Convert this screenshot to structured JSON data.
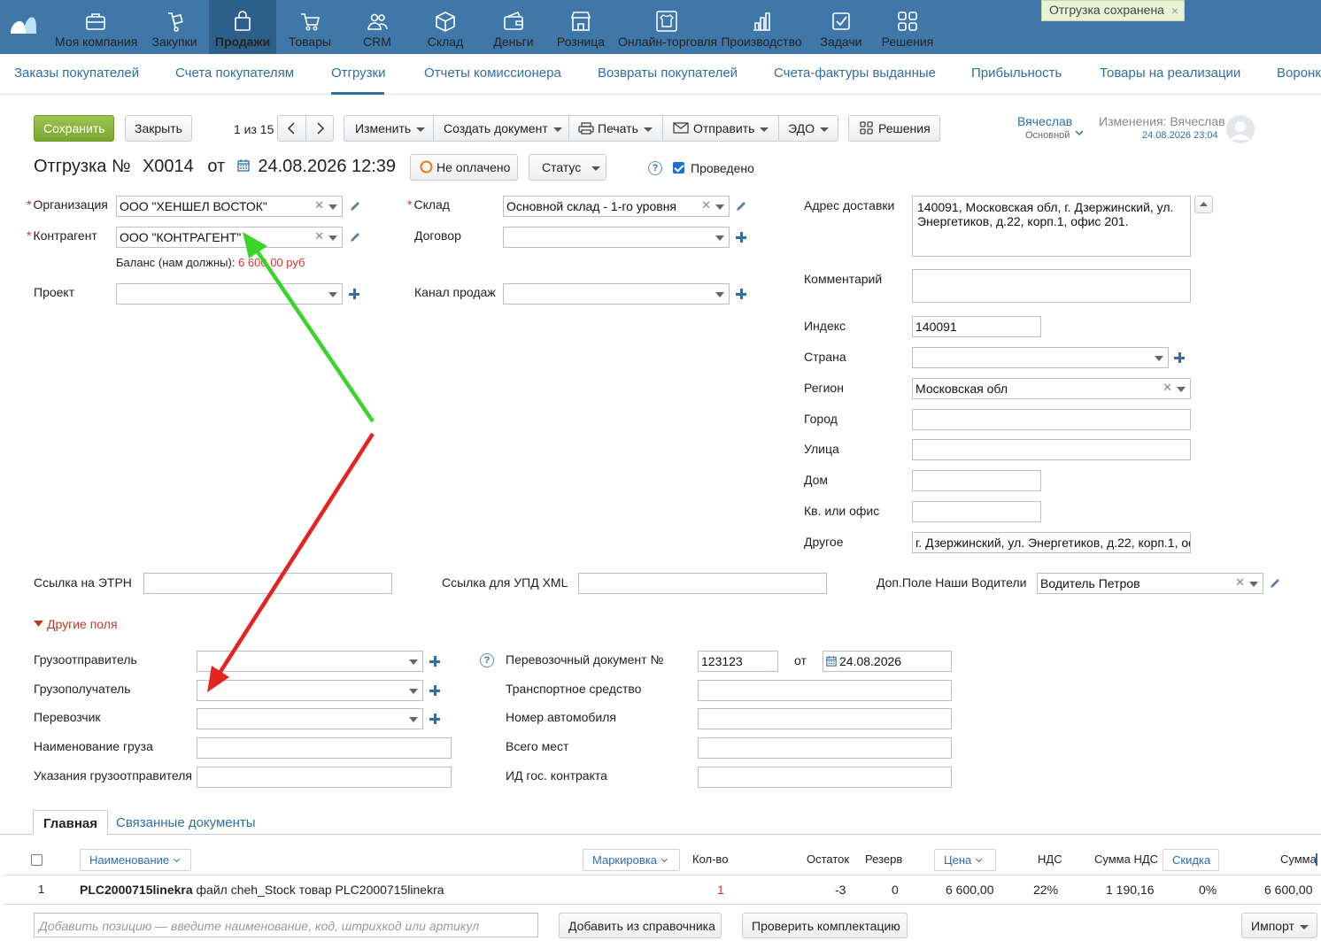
{
  "nav": {
    "items": [
      {
        "label": "Моя компания",
        "icon": "briefcase-icon"
      },
      {
        "label": "Закупки",
        "icon": "dolly-icon"
      },
      {
        "label": "Продажи",
        "icon": "shopping-bag-icon"
      },
      {
        "label": "Товары",
        "icon": "cart-icon"
      },
      {
        "label": "CRM",
        "icon": "people-icon"
      },
      {
        "label": "Склад",
        "icon": "box-icon"
      },
      {
        "label": "Деньги",
        "icon": "wallet-icon"
      },
      {
        "label": "Розница",
        "icon": "store-icon"
      },
      {
        "label": "Онлайн-торговля",
        "icon": "shirt-icon"
      },
      {
        "label": "Производство",
        "icon": "chart-bars-icon"
      },
      {
        "label": "Задачи",
        "icon": "checkbox-icon"
      },
      {
        "label": "Решения",
        "icon": "grid-icon"
      }
    ],
    "active": "Продажи",
    "accent": "#3e77a8"
  },
  "toast": {
    "text": "Отгрузка сохранена",
    "close": "×"
  },
  "subnav": {
    "items": [
      "Заказы покупателей",
      "Счета покупателям",
      "Отгрузки",
      "Отчеты комиссионера",
      "Возвраты покупателей",
      "Счета-фактуры выданные",
      "Прибыльность",
      "Товары на реализации",
      "Воронк"
    ],
    "active": "Отгрузки"
  },
  "toolbar": {
    "save": "Сохранить",
    "close": "Закрыть",
    "pager": "1 из 15",
    "edit": "Изменить",
    "create_doc": "Создать документ",
    "print": "Печать",
    "send": "Отправить",
    "edo": "ЭДО",
    "solutions": "Решения"
  },
  "user": {
    "name": "Вячеслав",
    "role": "Основной",
    "changes_label": "Изменения: Вячеслав",
    "changes_date": "24.08.2026 23:04"
  },
  "doc": {
    "title_prefix": "Отгрузка №",
    "number": "Х0014",
    "from": "от",
    "datetime": "24.08.2026 12:39",
    "payment_status": "Не оплачено",
    "status_button": "Статус",
    "posted_label": "Проведено",
    "posted": true
  },
  "form_left": {
    "organization_label": "Организация",
    "organization_value": "ООО \"ХЕНШЕЛ ВОСТОК\"",
    "counterparty_label": "Контрагент",
    "counterparty_value": "ООО \"КОНТРАГЕНТ\"",
    "balance_label": "Баланс (нам должны):",
    "balance_value": "6 600,00 руб",
    "project_label": "Проект",
    "project_value": ""
  },
  "form_mid": {
    "warehouse_label": "Склад",
    "warehouse_value": "Основной склад - 1-го уровня",
    "contract_label": "Договор",
    "contract_value": "",
    "channel_label": "Канал продаж",
    "channel_value": ""
  },
  "form_right": {
    "address_label": "Адрес доставки",
    "address_value": "140091, Московская обл, г. Дзержинский,  ул. Энергетиков, д.22, корп.1, офис 201.",
    "comment_label": "Комментарий",
    "comment_value": "",
    "index_label": "Индекс",
    "index_value": "140091",
    "country_label": "Страна",
    "country_value": "",
    "region_label": "Регион",
    "region_value": "Московская обл",
    "city_label": "Город",
    "city_value": "",
    "street_label": "Улица",
    "street_value": "",
    "house_label": "Дом",
    "house_value": "",
    "apt_label": "Кв. или офис",
    "apt_value": "",
    "other_label": "Другое",
    "other_value": "г. Дзержинский,  ул. Энергетиков, д.22, корп.1, оф"
  },
  "links_row": {
    "etrn_label": "Ссылка на ЭТРН",
    "etrn_value": "",
    "upd_label": "Ссылка для УПД XML",
    "upd_value": "",
    "drivers_label": "Доп.Поле Наши Водители",
    "drivers_value": "Водитель Петров"
  },
  "other_fields": {
    "toggle": "Другие поля",
    "shipper_label": "Грузоотправитель",
    "consignee_label": "Грузополучатель",
    "carrier_label": "Перевозчик",
    "cargo_name_label": "Наименование груза",
    "shipper_instructions_label": "Указания грузоотправителя",
    "transport_doc_label": "Перевозочный документ №",
    "transport_doc_value": "123123",
    "transport_doc_from": "от",
    "transport_doc_date": "24.08.2026",
    "vehicle_label": "Транспортное средство",
    "car_number_label": "Номер автомобиля",
    "total_places_label": "Всего мест",
    "gov_contract_label": "ИД гос. контракта"
  },
  "tabs": {
    "main": "Главная",
    "related": "Связанные документы"
  },
  "table": {
    "headers": {
      "name": "Наименование",
      "marking": "Маркировка",
      "qty": "Кол-во",
      "stock": "Остаток",
      "reserve": "Резерв",
      "price": "Цена",
      "vat": "НДС",
      "vat_sum": "Сумма НДС",
      "discount": "Скидка",
      "sum": "Сумма"
    },
    "rows": [
      {
        "n": "1",
        "name_bold": "PLC2000715linekra",
        "name_rest": " файл cheh_Stock товар PLC2000715linekra",
        "qty": "1",
        "stock": "-3",
        "reserve": "0",
        "price": "6 600,00",
        "vat": "22%",
        "vat_sum": "1 190,16",
        "discount": "0%",
        "sum": "6 600,00"
      }
    ]
  },
  "bottom": {
    "add_placeholder": "Добавить позицию — введите наименование, код, штрихкод или артикул",
    "add_from_catalog": "Добавить из справочника",
    "check_kit": "Проверить комплектацию",
    "import": "Импорт"
  },
  "colors": {
    "arrow_green": "#3bd42a",
    "arrow_red": "#e52421",
    "link": "#2f6ea6",
    "save_green": "#86b33c"
  }
}
